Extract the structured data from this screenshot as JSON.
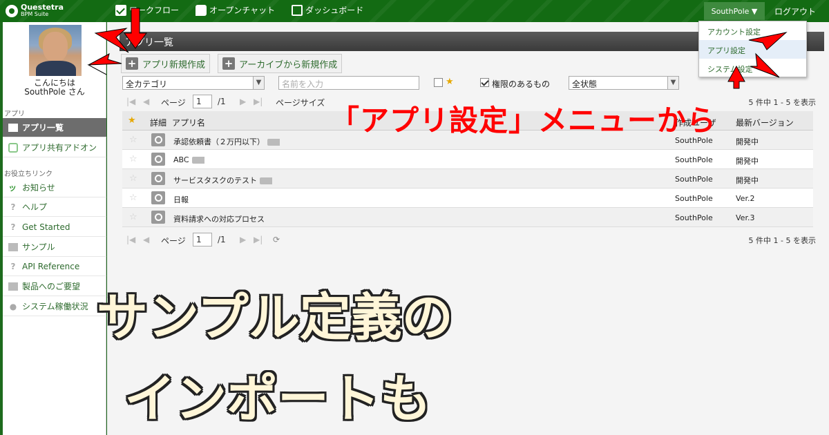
{
  "topbar": {
    "logo_line1": "Questetra",
    "logo_line2": "BPM Suite",
    "nav": [
      {
        "label": "ワークフロー",
        "icon": "check-icon"
      },
      {
        "label": "オープンチャット",
        "icon": "chat-icon"
      },
      {
        "label": "ダッシュボード",
        "icon": "dashboard-icon"
      }
    ],
    "user_menu": "SouthPole ▼",
    "logout": "ログアウト"
  },
  "dropdown": {
    "items": [
      "アカウント設定",
      "アプリ設定",
      "システム設定"
    ],
    "highlighted": "アプリ設定"
  },
  "sidebar": {
    "greeting_line1": "こんにちは",
    "greeting_line2": "SouthPole さん",
    "section_app": "アプリ",
    "app_items": [
      "アプリ一覧",
      "アプリ共有アドオン"
    ],
    "section_links": "お役立ちリンク",
    "link_items": [
      "お知らせ",
      "ヘルプ",
      "Get Started",
      "サンプル",
      "API Reference",
      "製品へのご要望",
      "システム稼働状況"
    ]
  },
  "main": {
    "title": "アプリ一覧",
    "btn_new": "アプリ新規作成",
    "btn_archive": "アーカイブから新規作成",
    "filter_category": "全カテゴリ",
    "filter_name_placeholder": "名前を入力",
    "filter_permission": "権限のあるもの",
    "filter_status": "全状態",
    "pager": {
      "page_label": "ページ",
      "page": "1",
      "total_pages": "/1",
      "page_size_label": "ページサイズ",
      "summary": "5 件中 1 - 5 を表示"
    },
    "columns": {
      "detail": "詳細",
      "name": "アプリ名",
      "user": "作成ユーザ",
      "version": "最新バージョン"
    },
    "rows": [
      {
        "name": "承認依頼書（２万円以下）",
        "user": "SouthPole",
        "version": "開発中",
        "starred": true
      },
      {
        "name": "ABC",
        "user": "SouthPole",
        "version": "開発中",
        "starred": false
      },
      {
        "name": "サービスタスクのテスト",
        "user": "SouthPole",
        "version": "開発中",
        "starred": false
      },
      {
        "name": "日報",
        "user": "SouthPole",
        "version": "Ver.2",
        "starred": false
      },
      {
        "name": "資料請求への対応プロセス",
        "user": "SouthPole",
        "version": "Ver.3",
        "starred": false
      }
    ]
  },
  "annotations": {
    "red_caption": "「アプリ設定」メニューから",
    "big_line1": "サンプル定義の",
    "big_line2": "インポートも",
    "arrow_color": "#ff0000"
  }
}
